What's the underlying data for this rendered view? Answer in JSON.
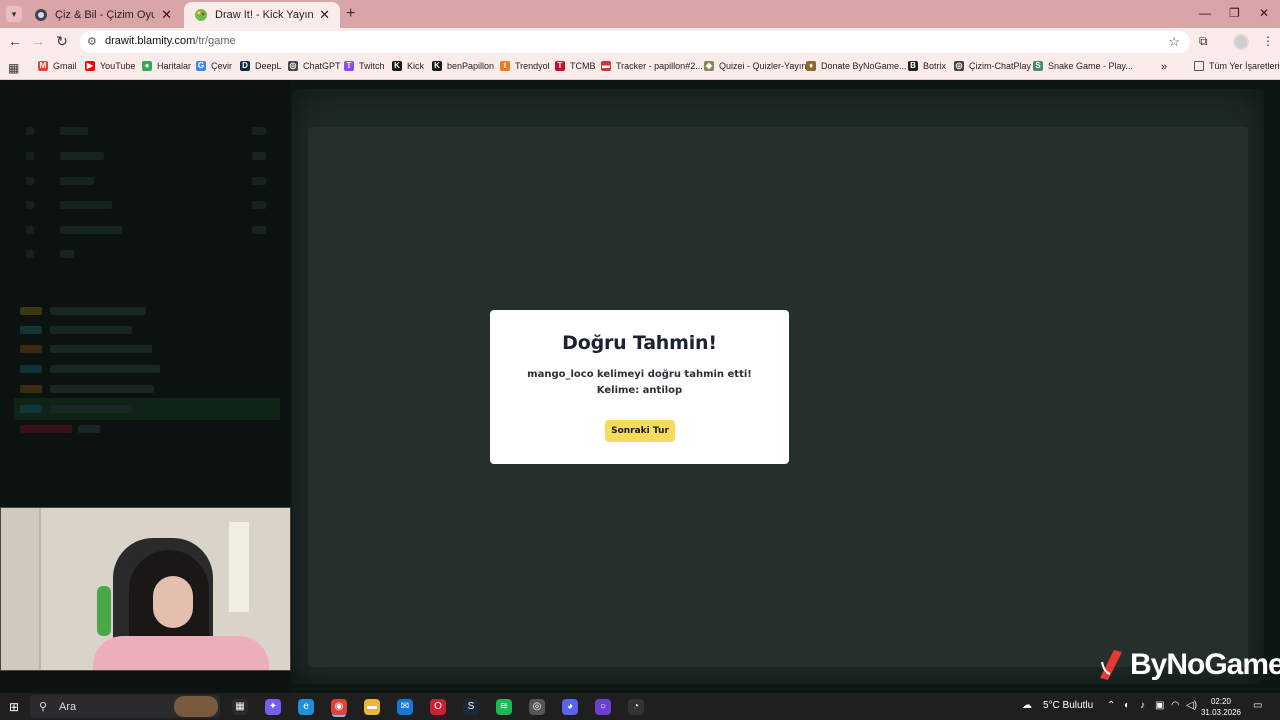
{
  "browser": {
    "tabs": [
      {
        "title": "Çiz & Bil - Çizim Oyunu",
        "close": "✕"
      },
      {
        "title": "Draw It! - Kick Yayınları İçin Çizim",
        "close": "✕"
      }
    ],
    "new_tab": "+",
    "window_controls": {
      "minimize": "—",
      "restore": "❐",
      "close": "✕"
    },
    "url_host": "drawit.blamity.com",
    "url_path": "/tr/game"
  },
  "bookmarks": [
    {
      "label": "Gmail",
      "icon": "gmail-icon",
      "color": "#ea4335",
      "glyph": "M"
    },
    {
      "label": "YouTube",
      "icon": "youtube-icon",
      "color": "#ff0000",
      "glyph": "▶"
    },
    {
      "label": "Haritalar",
      "icon": "maps-icon",
      "color": "#34a853",
      "glyph": "●"
    },
    {
      "label": "Çevir",
      "icon": "translate-icon",
      "color": "#4285f4",
      "glyph": "G"
    },
    {
      "label": "DeepL",
      "icon": "deepl-icon",
      "color": "#0f2b46",
      "glyph": "D"
    },
    {
      "label": "ChatGPT",
      "icon": "chatgpt-icon",
      "color": "#444444",
      "glyph": "◎"
    },
    {
      "label": "Twitch",
      "icon": "twitch-icon",
      "color": "#9146ff",
      "glyph": "T"
    },
    {
      "label": "Kick",
      "icon": "kick-icon",
      "color": "#1a1a1a",
      "glyph": "K"
    },
    {
      "label": "benPapillon",
      "icon": "kick-icon",
      "color": "#1a1a1a",
      "glyph": "K"
    },
    {
      "label": "Trendyol",
      "icon": "trendyol-icon",
      "color": "#f27a1a",
      "glyph": "t"
    },
    {
      "label": "TCMB",
      "icon": "tcmb-icon",
      "color": "#c8102e",
      "glyph": "T"
    },
    {
      "label": "Tracker - papillon#2...",
      "icon": "tracker-icon",
      "color": "#d13639",
      "glyph": "▬"
    },
    {
      "label": "Quizei - Quizler-Yayın",
      "icon": "quizei-icon",
      "color": "#888855",
      "glyph": "◆"
    },
    {
      "label": "Donate ByNoGame...",
      "icon": "bynogame-icon",
      "color": "#8a6d2a",
      "glyph": "♦"
    },
    {
      "label": "Botrix",
      "icon": "botrix-icon",
      "color": "#222222",
      "glyph": "B"
    },
    {
      "label": "Çizim-ChatPlay",
      "icon": "chatplay-icon",
      "color": "#444444",
      "glyph": "◎"
    },
    {
      "label": "Snake Game - Play...",
      "icon": "snake-icon",
      "color": "#4a8a6a",
      "glyph": "S"
    }
  ],
  "all_bookmarks": "Tüm Yer İşaretleri",
  "bookmarks_more": "»",
  "modal": {
    "title": "Doğru Tahmin!",
    "message": "mango_loco kelimeyi doğru tahmin etti! Kelime: antilop",
    "button": "Sonraki Tur"
  },
  "brand": "ByNoGame",
  "taskbar": {
    "search_placeholder": "Ara",
    "weather": "5°C  Bulutlu",
    "time": "02:20",
    "date": "31.03.2026",
    "apps": [
      {
        "name": "task-view-icon",
        "color": "#2b2b2d",
        "glyph": "▦"
      },
      {
        "name": "copilot-icon",
        "color": "#7a5cf0",
        "glyph": "✦"
      },
      {
        "name": "edge-icon",
        "color": "#1f8fd8",
        "glyph": "e"
      },
      {
        "name": "chrome-icon",
        "color": "#db4437",
        "glyph": "◉"
      },
      {
        "name": "file-explorer-icon",
        "color": "#e7b73a",
        "glyph": "▬"
      },
      {
        "name": "mail-icon",
        "color": "#1877d6",
        "glyph": "✉"
      },
      {
        "name": "opera-icon",
        "color": "#d11f2f",
        "glyph": "O"
      },
      {
        "name": "steam-icon",
        "color": "#1b2838",
        "glyph": "S"
      },
      {
        "name": "spotify-icon",
        "color": "#1db954",
        "glyph": "≋"
      },
      {
        "name": "browser-icon",
        "color": "#555555",
        "glyph": "◎"
      },
      {
        "name": "discord-icon",
        "color": "#5865f2",
        "glyph": "◕"
      },
      {
        "name": "obs-icon",
        "color": "#6a3fd1",
        "glyph": "○"
      },
      {
        "name": "app-icon",
        "color": "#333333",
        "glyph": "◔"
      }
    ]
  },
  "colors": {
    "tab_strip": "#d9a5a7",
    "toolbar": "#fbecec",
    "page_bg": "#0c1714",
    "modal_button": "#f5dc5a"
  }
}
